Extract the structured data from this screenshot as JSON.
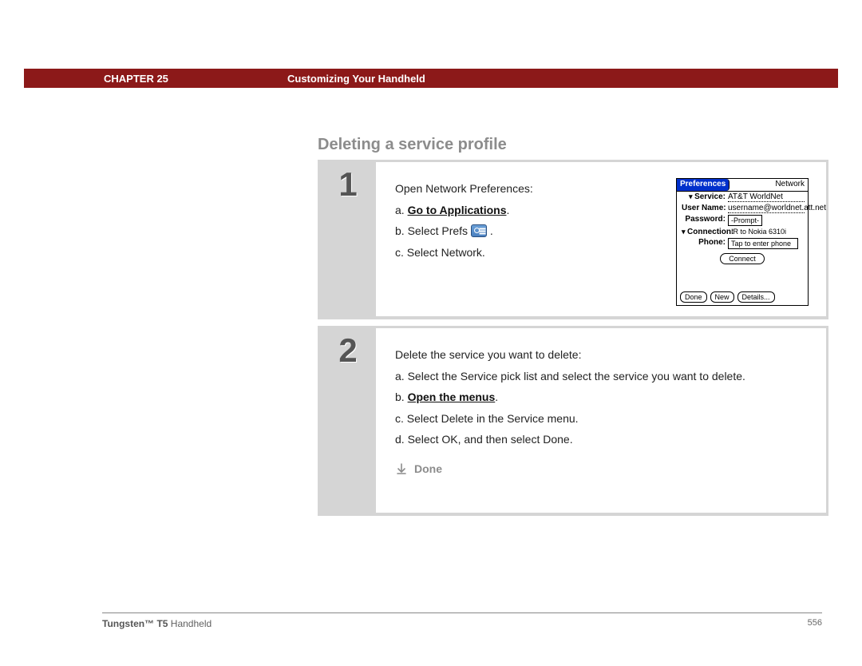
{
  "header": {
    "chapter": "CHAPTER 25",
    "title": "Customizing Your Handheld"
  },
  "section_title": "Deleting a service profile",
  "step1": {
    "number": "1",
    "intro": "Open Network Preferences:",
    "a_prefix": "a.",
    "a_link": "Go to Applications",
    "a_suffix": ".",
    "b_prefix": "b.",
    "b_text": "Select Prefs",
    "b_suffix": ".",
    "c_prefix": "c.",
    "c_text": "Select Network."
  },
  "palm": {
    "title_left": "Preferences",
    "title_right": "Network",
    "service_label": "Service:",
    "service_value": "AT&T WorldNet",
    "username_label": "User Name:",
    "username_value": "username@worldnet.att.net",
    "password_label": "Password:",
    "password_value": "-Prompt-",
    "connection_label": "Connection:",
    "connection_value": "IR to Nokia 6310i",
    "phone_label": "Phone:",
    "phone_value": "Tap to enter phone",
    "connect_btn": "Connect",
    "done_btn": "Done",
    "new_btn": "New",
    "details_btn": "Details..."
  },
  "step2": {
    "number": "2",
    "intro": "Delete the service you want to delete:",
    "a_prefix": "a.",
    "a_text": "Select the Service pick list and select the service you want to delete.",
    "b_prefix": "b.",
    "b_link": "Open the menus",
    "b_suffix": ".",
    "c_prefix": "c.",
    "c_text": "Select Delete in the Service menu.",
    "d_prefix": "d.",
    "d_text": "Select OK, and then select Done.",
    "done_label": "Done"
  },
  "footer": {
    "product_bold": "Tungsten™ T5",
    "product_rest": " Handheld",
    "page": "556"
  }
}
